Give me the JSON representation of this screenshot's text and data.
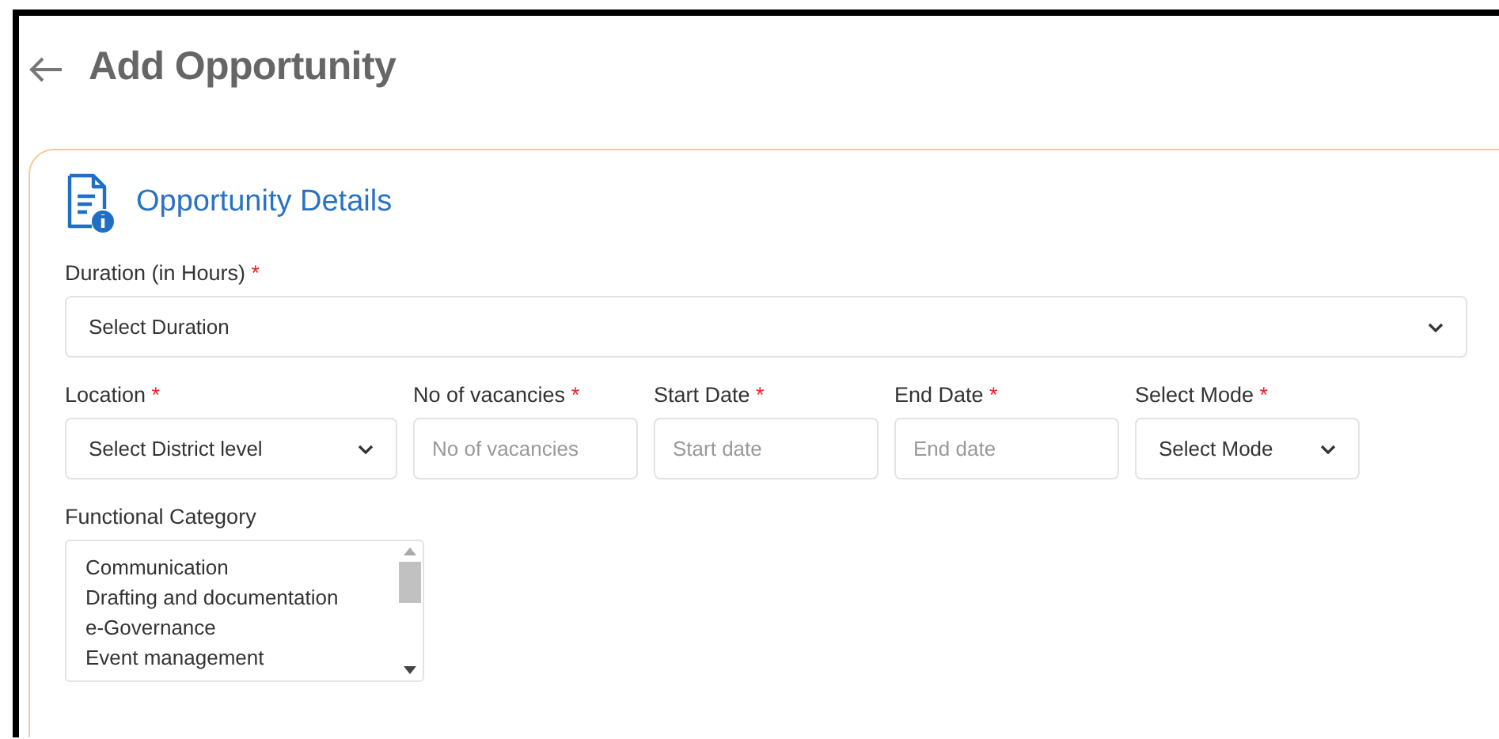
{
  "page": {
    "title": "Add Opportunity"
  },
  "section": {
    "title": "Opportunity Details"
  },
  "rows": [
    [
      {
        "kind": "select",
        "label": "Duration (in Hours)",
        "required_mark": "*",
        "value": "Select Duration"
      }
    ],
    [
      {
        "kind": "select",
        "label": "Location",
        "required_mark": "*",
        "value": "Select District level"
      },
      {
        "kind": "input",
        "label": "No of vacancies",
        "required_mark": "*",
        "placeholder": "No of vacancies"
      },
      {
        "kind": "input",
        "label": "Start Date",
        "required_mark": "*",
        "placeholder": "Start date"
      },
      {
        "kind": "input",
        "label": "End Date",
        "required_mark": "*",
        "placeholder": "End date"
      },
      {
        "kind": "select",
        "label": "Select Mode",
        "required_mark": "*",
        "value": "Select Mode"
      }
    ],
    [
      {
        "kind": "listbox",
        "label": "Functional Category",
        "options": [
          "Communication",
          "Drafting and documentation",
          "e-Governance",
          "Event management"
        ]
      }
    ]
  ]
}
